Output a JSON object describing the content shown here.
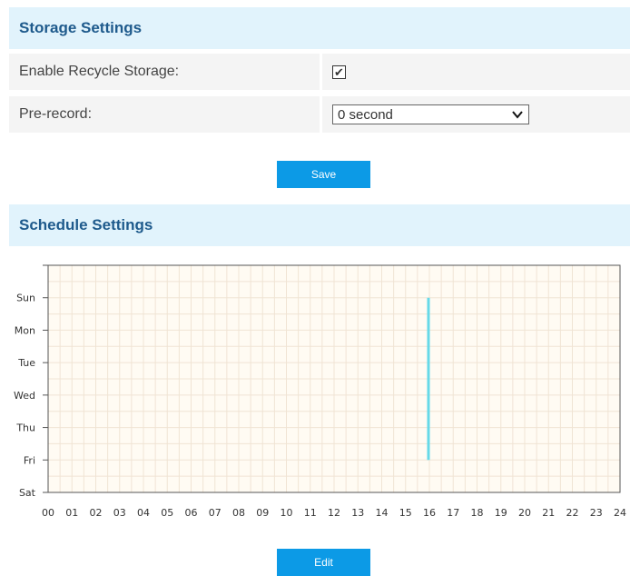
{
  "storage": {
    "title": "Storage Settings",
    "recycle_label": "Enable Recycle Storage:",
    "recycle_checked": true,
    "prerecord_label": "Pre-record:",
    "prerecord_value": "0 second",
    "save_label": "Save"
  },
  "schedule": {
    "title": "Schedule Settings",
    "days": [
      "Sun",
      "Mon",
      "Tue",
      "Wed",
      "Thu",
      "Fri",
      "Sat"
    ],
    "hours": [
      "00",
      "01",
      "02",
      "03",
      "04",
      "05",
      "06",
      "07",
      "08",
      "09",
      "10",
      "11",
      "12",
      "13",
      "14",
      "15",
      "16",
      "17",
      "18",
      "19",
      "20",
      "21",
      "22",
      "23",
      "24"
    ],
    "marker_hour": 16,
    "marker_day_span": [
      "Sun",
      "Fri"
    ],
    "grid_color": "#f0e4d4",
    "background_color": "#fffbf3",
    "marker_color": "#66d9e8",
    "edit_label": "Edit"
  },
  "colors": {
    "header_bg": "#e1f3fc",
    "header_text": "#1e5a8c",
    "row_bg": "#f4f4f4",
    "button_bg": "#0c9ae6"
  }
}
